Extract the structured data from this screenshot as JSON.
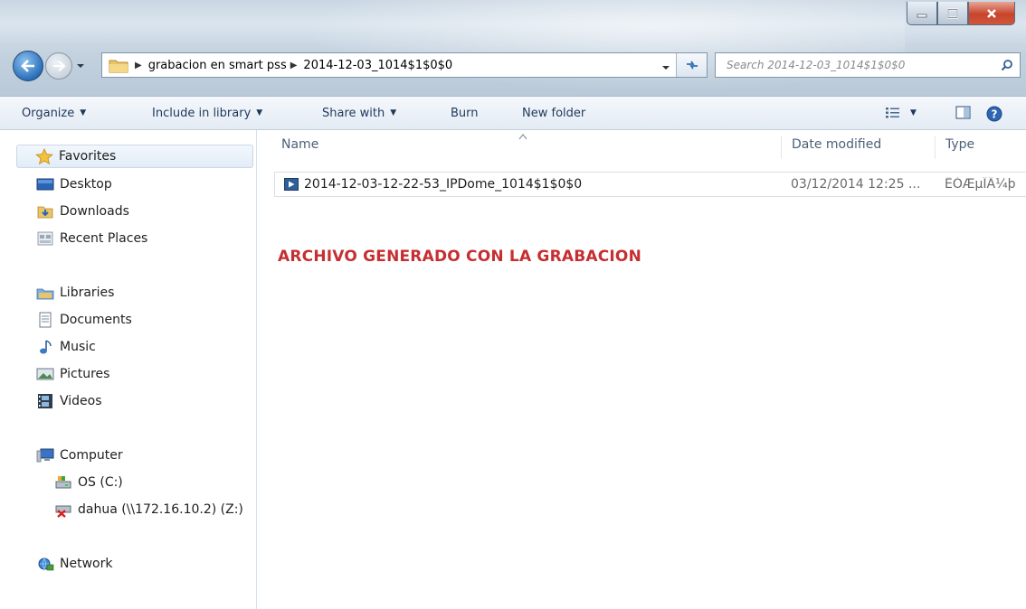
{
  "window": {
    "address": {
      "crumbs": [
        "grabacion en smart pss",
        "2014-12-03_1014$1$0$0"
      ]
    },
    "search": {
      "placeholder": "Search 2014-12-03_1014$1$0$0"
    }
  },
  "toolbar": {
    "organize_label": "Organize",
    "include_label": "Include in library",
    "share_label": "Share with",
    "burn_label": "Burn",
    "new_folder_label": "New folder"
  },
  "nav": {
    "favorites": {
      "label": "Favorites",
      "icon": "star-icon"
    },
    "favorites_items": [
      {
        "label": "Desktop",
        "icon": "desktop-icon"
      },
      {
        "label": "Downloads",
        "icon": "downloads-icon"
      },
      {
        "label": "Recent Places",
        "icon": "recent-places-icon"
      }
    ],
    "libraries": {
      "label": "Libraries",
      "icon": "libraries-icon"
    },
    "libraries_items": [
      {
        "label": "Documents",
        "icon": "documents-icon"
      },
      {
        "label": "Music",
        "icon": "music-icon"
      },
      {
        "label": "Pictures",
        "icon": "pictures-icon"
      },
      {
        "label": "Videos",
        "icon": "videos-icon"
      }
    ],
    "computer": {
      "label": "Computer",
      "icon": "computer-icon"
    },
    "computer_items": [
      {
        "label": "OS (C:)",
        "icon": "drive-icon"
      },
      {
        "label": "dahua (\\\\172.16.10.2) (Z:)",
        "icon": "disconnected-network-drive-icon"
      }
    ],
    "network": {
      "label": "Network",
      "icon": "network-icon"
    }
  },
  "content": {
    "columns": {
      "name": "Name",
      "date": "Date modified",
      "type": "Type"
    },
    "files": [
      {
        "name": "2014-12-03-12-22-53_IPDome_1014$1$0$0",
        "date": "03/12/2014 12:25 ...",
        "type": "ÊÓÆµÎÄ¼þ",
        "icon": "video-file-icon"
      }
    ],
    "annotation": "ARCHIVO GENERADO CON LA GRABACION"
  },
  "colors": {
    "annotation": "#c62f32",
    "titlebar": "#c4d2df",
    "close_button": "#c8442b",
    "command_text": "#1e395b"
  }
}
